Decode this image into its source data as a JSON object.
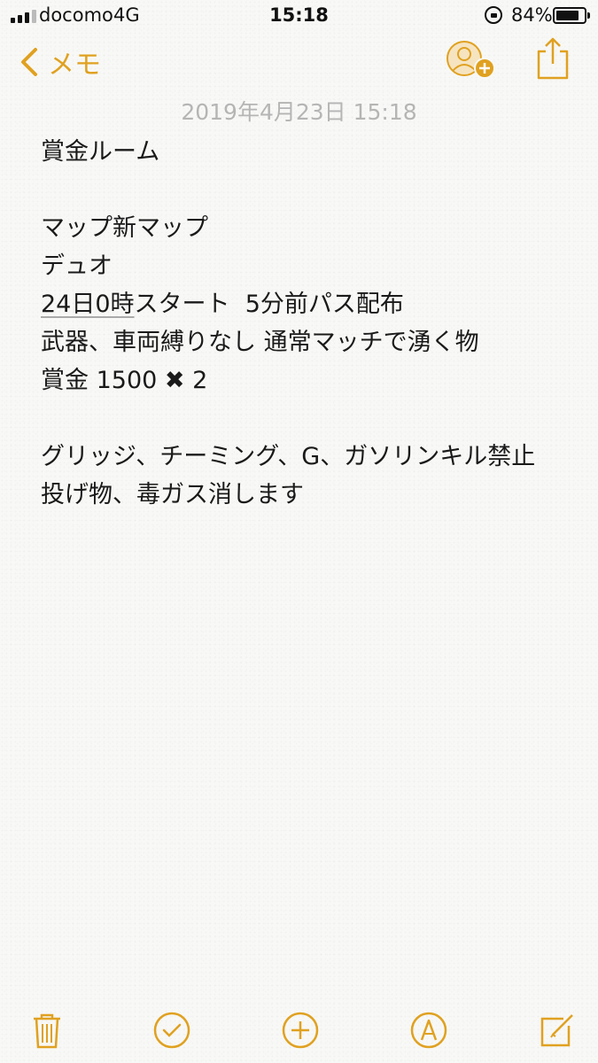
{
  "status_bar": {
    "carrier": "docomo",
    "network": "4G",
    "time": "15:18",
    "battery_percent": "84%",
    "battery_level": 0.84
  },
  "nav": {
    "back_label": "メモ",
    "back_icon": "chevron-left-icon",
    "collab_icon": "add-person-icon",
    "share_icon": "share-icon"
  },
  "note": {
    "date": "2019年4月23日 15:18",
    "lines": [
      "賞金ルーム",
      "",
      "マップ新マップ",
      "デュオ",
      {
        "underlined": "24日0時",
        "rest": "スタート  5分前パス配布"
      },
      "武器、車両縛りなし 通常マッチで湧く物",
      "賞金 1500 ✖︎ 2",
      "",
      "グリッジ、チーミング、G、ガソリンキル禁止",
      "投げ物、毒ガス消します"
    ]
  },
  "toolbar": {
    "items": [
      "trash-icon",
      "checklist-icon",
      "add-icon",
      "markup-icon",
      "compose-icon"
    ]
  },
  "colors": {
    "accent": "#e0a120",
    "date_text": "#b5b5b5",
    "body_text": "#1a1a1a",
    "background": "#f8f8f6"
  }
}
